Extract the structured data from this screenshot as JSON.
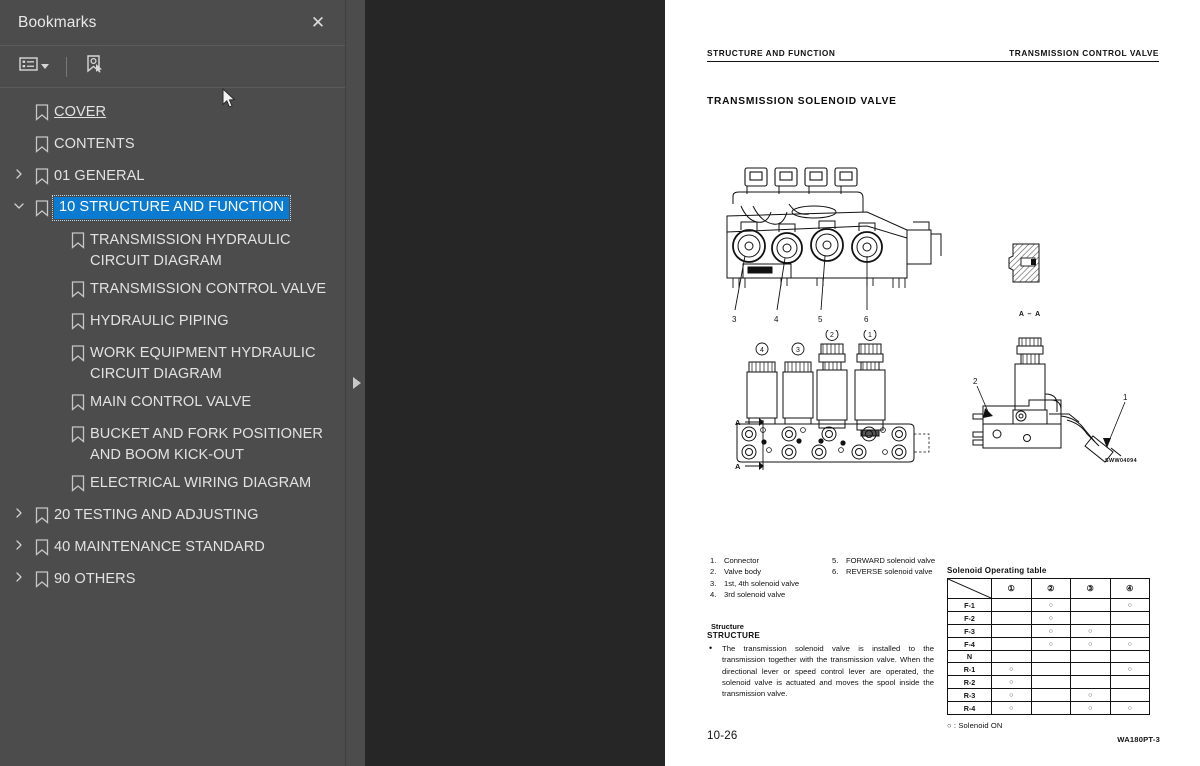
{
  "sidebar": {
    "title": "Bookmarks",
    "close_label": "✕",
    "toolbar": {
      "options_icon": "list-options-icon",
      "new_bookmark_icon": "new-bookmark-icon"
    },
    "items": [
      {
        "label": "COVER",
        "level": 0,
        "twisty": "none",
        "selected": false,
        "link": true
      },
      {
        "label": "CONTENTS",
        "level": 0,
        "twisty": "none",
        "selected": false,
        "link": false
      },
      {
        "label": "01 GENERAL",
        "level": 0,
        "twisty": "collapsed",
        "selected": false,
        "link": false
      },
      {
        "label": "10 STRUCTURE AND FUNCTION",
        "level": 0,
        "twisty": "expanded",
        "selected": true,
        "link": false
      },
      {
        "label": "TRANSMISSION HYDRAULIC CIRCUIT DIAGRAM",
        "level": 1,
        "twisty": "none",
        "selected": false,
        "link": false
      },
      {
        "label": "TRANSMISSION CONTROL VALVE",
        "level": 1,
        "twisty": "none",
        "selected": false,
        "link": false
      },
      {
        "label": "HYDRAULIC PIPING",
        "level": 1,
        "twisty": "none",
        "selected": false,
        "link": false
      },
      {
        "label": "WORK EQUIPMENT HYDRAULIC CIRCUIT DIAGRAM",
        "level": 1,
        "twisty": "none",
        "selected": false,
        "link": false
      },
      {
        "label": "MAIN CONTROL VALVE",
        "level": 1,
        "twisty": "none",
        "selected": false,
        "link": false
      },
      {
        "label": "BUCKET AND FORK POSITIONER AND BOOM KICK-OUT",
        "level": 1,
        "twisty": "none",
        "selected": false,
        "link": false
      },
      {
        "label": "ELECTRICAL WIRING DIAGRAM",
        "level": 1,
        "twisty": "none",
        "selected": false,
        "link": false
      },
      {
        "label": "20 TESTING AND ADJUSTING",
        "level": 0,
        "twisty": "collapsed",
        "selected": false,
        "link": false
      },
      {
        "label": "40 MAINTENANCE STANDARD",
        "level": 0,
        "twisty": "collapsed",
        "selected": false,
        "link": false
      },
      {
        "label": "90 OTHERS",
        "level": 0,
        "twisty": "collapsed",
        "selected": false,
        "link": false
      }
    ],
    "selection_color": "#0b7ad1"
  },
  "splitter": {
    "expand_icon": "expand-panel-arrow-icon"
  },
  "document": {
    "header_left": "STRUCTURE AND FUNCTION",
    "header_right": "TRANSMISSION CONTROL VALVE",
    "section_title": "TRANSMISSION SOLENOID VALVE",
    "figure_code": "SWW04094",
    "section_marker": "A – A",
    "page_number": "10-26",
    "doc_code": "WA180PT-3",
    "parts_left": [
      {
        "num": "1.",
        "text": "Connector"
      },
      {
        "num": "2.",
        "text": "Valve body"
      },
      {
        "num": "3.",
        "text": "1st, 4th solenoid valve"
      },
      {
        "num": "4.",
        "text": "3rd solenoid valve"
      }
    ],
    "parts_right": [
      {
        "num": "5.",
        "text": "FORWARD solenoid valve"
      },
      {
        "num": "6.",
        "text": "REVERSE solenoid valve"
      }
    ],
    "structure_sub": "Structure",
    "structure_head": "STRUCTURE",
    "structure_bullet": "•",
    "structure_text": "The transmission solenoid valve is  installed to the transmission together with the transmission valve. When the directional lever or speed control lever are operated, the solenoid valve is actuated and moves the spool inside the transmission valve.",
    "callouts_top": [
      "3",
      "4",
      "5",
      "6"
    ],
    "callouts_mid": [
      "④",
      "③",
      "②",
      "①"
    ],
    "callouts_right": [
      "2",
      "1"
    ]
  },
  "chart_data": {
    "type": "table",
    "title": "Solenoid Operating table",
    "note": "○ : Solenoid ON",
    "corner_label": "",
    "columns": [
      "①",
      "②",
      "③",
      "④"
    ],
    "rows": [
      {
        "label": "F-1",
        "on": [
          false,
          true,
          false,
          true
        ]
      },
      {
        "label": "F-2",
        "on": [
          false,
          true,
          false,
          false
        ]
      },
      {
        "label": "F-3",
        "on": [
          false,
          true,
          true,
          false
        ]
      },
      {
        "label": "F-4",
        "on": [
          false,
          true,
          true,
          true
        ]
      },
      {
        "label": "N",
        "on": [
          false,
          false,
          false,
          false
        ]
      },
      {
        "label": "R-1",
        "on": [
          true,
          false,
          false,
          true
        ]
      },
      {
        "label": "R-2",
        "on": [
          true,
          false,
          false,
          false
        ]
      },
      {
        "label": "R-3",
        "on": [
          true,
          false,
          true,
          false
        ]
      },
      {
        "label": "R-4",
        "on": [
          true,
          false,
          true,
          true
        ]
      }
    ],
    "on_symbol": "○"
  }
}
